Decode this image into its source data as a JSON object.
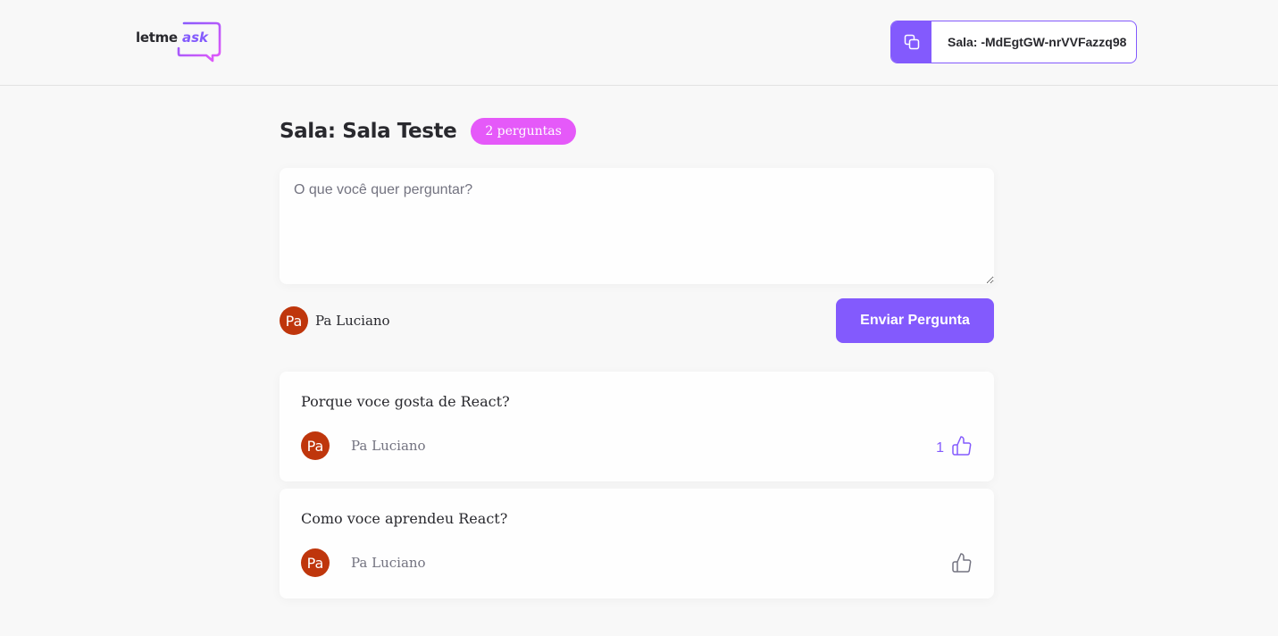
{
  "header": {
    "logo": {
      "part1": "letme",
      "part2": "ask"
    },
    "room_code": {
      "label": "Sala: -MdEgtGW-nrVVFazzq98"
    }
  },
  "main": {
    "room_title": "Sala: Sala Teste",
    "question_count": "2 perguntas",
    "form": {
      "placeholder": "O que você quer perguntar?",
      "value": "",
      "user": {
        "avatar": "Pa",
        "name": "Pa Luciano"
      },
      "submit_label": "Enviar Pergunta"
    },
    "questions": [
      {
        "content": "Porque voce gosta de React?",
        "author": {
          "avatar": "Pa",
          "name": "Pa Luciano"
        },
        "likes": "1",
        "liked": true
      },
      {
        "content": "Como voce aprendeu React?",
        "author": {
          "avatar": "Pa",
          "name": "Pa Luciano"
        },
        "likes": "",
        "liked": false
      }
    ]
  },
  "colors": {
    "accent": "#835afd",
    "badge": "#e559f9",
    "avatar": "#bf360c",
    "background": "#f8f8f8",
    "muted_text": "#737380"
  },
  "icons": {
    "copy": "copy-icon",
    "like": "thumbs-up-icon",
    "logo": "speech-bubble-logo"
  }
}
